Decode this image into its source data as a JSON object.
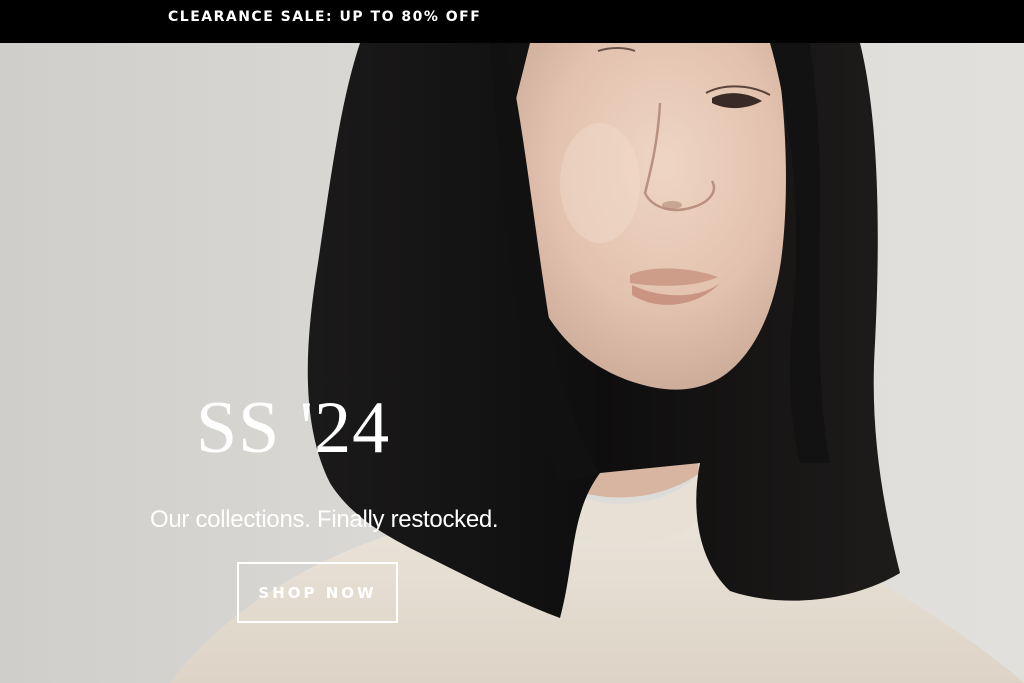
{
  "announcement": {
    "text": "CLEARANCE SALE: UP TO 80% OFF"
  },
  "hero": {
    "title": "SS '24",
    "subtitle": "Our collections. Finally restocked.",
    "cta_label": "SHOP NOW",
    "image_alt": "Model with black bob haircut wearing a cream knit turtleneck sweater"
  },
  "colors": {
    "announcement_bg": "#000000",
    "announcement_text": "#ffffff",
    "hero_text": "#ffffff",
    "hair": "#141313",
    "sweater": "#e5ddd1",
    "skin": "#e2c3b0",
    "background": "#dcdad6"
  }
}
